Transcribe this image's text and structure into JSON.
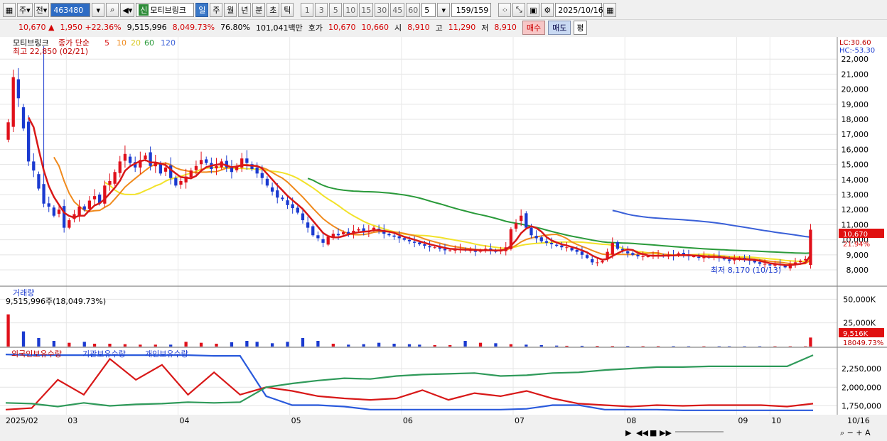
{
  "toolbar": {
    "market": "주",
    "market2": "전",
    "code": "463480",
    "stock_tag": "신",
    "stock_name": "모티브링크",
    "periods": [
      "일",
      "주",
      "월",
      "년",
      "분",
      "초",
      "틱"
    ],
    "numbers": [
      "1",
      "3",
      "5",
      "10",
      "15",
      "30",
      "45",
      "60"
    ],
    "count": "5",
    "page": "159",
    "page_total": "/159",
    "date": "2025/10/16"
  },
  "quote": {
    "price": "10,670",
    "arrow": "▲",
    "change": "1,950",
    "change_pct": "+22.36%",
    "volume": "9,515,996",
    "volume_pct": "8,049.73%",
    "rate": "76.80%",
    "amount": "101,041백만",
    "ask_label": "호가",
    "ask": "10,670",
    "bid": "10,660",
    "open_label": "시",
    "open": "8,910",
    "high_label": "고",
    "high": "11,290",
    "low_label": "저",
    "low": "8,910",
    "buy": "매수",
    "sell": "매도",
    "eval": "평"
  },
  "legend": {
    "name": "모티브링크",
    "ma_label": "종가 단순",
    "ma_periods": [
      "5",
      "10",
      "20",
      "60",
      "120"
    ],
    "max_label": "최고 22,850 (02/21)",
    "min_label": "최저 8,170 (10/13)",
    "lc": "LC:30.60",
    "hc": "HC:-53.30",
    "last_price_tag": "10,670",
    "last_pct_tag": "21.94%"
  },
  "volume_panel": {
    "title": "거래량",
    "value": "9,515,996주(18,049.73%)",
    "axis": [
      "50,000K",
      "25,000K"
    ],
    "last_tag": "9,516K",
    "last_tag2": "18049.73%"
  },
  "holding_panel": {
    "titles": [
      "외국인보유수량",
      "기관보유수량",
      "개인보유수량"
    ],
    "axis": [
      "2,250,000",
      "2,000,000",
      "1,750,000"
    ]
  },
  "colors": {
    "up": "#e0101a",
    "down": "#1a3ad0",
    "ma5": "#d81818",
    "ma10": "#f08a1c",
    "ma20": "#f2e22a",
    "ma60": "#2a9a3a",
    "ma120": "#3a60d8",
    "foreign": "#2a5adc",
    "institution": "#d81818",
    "individual": "#2f9a5a"
  },
  "chart_data": [
    {
      "type": "candlestick",
      "title": "모티브링크",
      "x_labels": [
        "2025/02",
        "03",
        "04",
        "05",
        "06",
        "07",
        "08",
        "09",
        "10",
        "10/16"
      ],
      "ylim": [
        7200,
        23000
      ],
      "y_ticks": [
        "22,000",
        "21,000",
        "20,000",
        "19,000",
        "18,000",
        "17,000",
        "16,000",
        "15,000",
        "14,000",
        "13,000",
        "12,000",
        "11,000",
        "10,000",
        "9,000",
        "8,000"
      ],
      "phases": [
        {
          "name": "Feb",
          "from": 0,
          "to": 12,
          "close": [
            17800,
            20800,
            19400,
            17400,
            15200,
            14600,
            13400,
            12400,
            12200,
            11600,
            12000,
            10800
          ],
          "high": 22850
        },
        {
          "name": "Mar",
          "from": 12,
          "to": 34,
          "close": [
            11300,
            11700,
            12200,
            12000,
            12600,
            12900,
            12400,
            13600,
            13900,
            14500,
            15200,
            15700,
            15100,
            14800,
            15300,
            15600,
            14900,
            15100,
            14400,
            14800,
            14100,
            13600
          ]
        },
        {
          "name": "Apr",
          "from": 34,
          "to": 56,
          "close": [
            13900,
            14200,
            14600,
            14900,
            15300,
            15100,
            14700,
            14900,
            15200,
            14800,
            14500,
            14900,
            15400,
            15100,
            14700,
            14400,
            14100,
            13600,
            13200,
            12800,
            12700,
            12300
          ]
        },
        {
          "name": "May",
          "from": 56,
          "to": 78,
          "close": [
            12100,
            11800,
            11300,
            10800,
            10300,
            10100,
            9800,
            10200,
            10400,
            10300,
            10500,
            10400,
            10600,
            10700,
            10500,
            10600,
            10800,
            10600,
            10400,
            10300,
            10200,
            10100
          ]
        },
        {
          "name": "Jun",
          "from": 78,
          "to": 100,
          "close": [
            10000,
            9900,
            9800,
            9700,
            9600,
            9500,
            9500,
            9400,
            9300,
            9300,
            9400,
            9400,
            9300,
            9300,
            9200,
            9300,
            9400,
            9300,
            9200,
            9300,
            9500,
            10700
          ]
        },
        {
          "name": "Jul",
          "from": 100,
          "to": 122,
          "close": [
            11100,
            11600,
            10800,
            10300,
            10100,
            9900,
            9800,
            9700,
            9600,
            9500,
            9500,
            9300,
            9200,
            9000,
            8800,
            8500,
            8500,
            8600,
            9200,
            9800,
            9400,
            9300
          ]
        },
        {
          "name": "Aug",
          "from": 122,
          "to": 144,
          "close": [
            9100,
            9000,
            8900,
            8900,
            8900,
            9000,
            9000,
            8900,
            9000,
            8900,
            9100,
            9000,
            8900,
            8900,
            8800,
            8900,
            8800,
            8900,
            8800,
            8700,
            8600,
            8700
          ]
        },
        {
          "name": "Sep-Oct",
          "from": 144,
          "to": 159,
          "close": [
            8800,
            8700,
            8600,
            8500,
            8400,
            8400,
            8300,
            8400,
            8300,
            8170,
            8400,
            8500,
            8600,
            8720,
            10670
          ]
        }
      ],
      "last_close": 10670,
      "max": {
        "value": 22850,
        "date": "02/21"
      },
      "min": {
        "value": 8170,
        "date": "10/13"
      }
    },
    {
      "type": "bar",
      "title": "거래량",
      "ylim": [
        0,
        60000
      ],
      "y_unit": "K",
      "values": [
        34000,
        16000,
        9000,
        6000,
        4000,
        5000,
        3000,
        3000,
        2500,
        2000,
        2000,
        2000,
        5000,
        4000,
        3000,
        4500,
        6000,
        5000,
        3500,
        5000,
        9000,
        6000,
        3000,
        2000,
        2500,
        4000,
        3000,
        2500,
        2000,
        1500,
        1500,
        6000,
        4000,
        3500,
        2500,
        2000,
        1500,
        1000,
        800,
        800,
        700,
        600,
        600,
        500,
        500,
        500,
        400,
        400,
        400,
        400,
        400,
        400,
        400,
        400,
        400,
        9516
      ],
      "last": 9516
    },
    {
      "type": "line",
      "title": "외국인보유수량 · 기관보유수량 · 개인보유수량",
      "ylim": [
        1650000,
        2450000
      ],
      "series": [
        {
          "name": "외국인보유수량",
          "values": [
            2440000,
            2430000,
            2430000,
            2430000,
            2430000,
            2430000,
            2430000,
            2430000,
            2420000,
            2420000,
            1880000,
            1760000,
            1760000,
            1740000,
            1700000,
            1700000,
            1700000,
            1700000,
            1700000,
            1700000,
            1710000,
            1760000,
            1760000,
            1700000,
            1700000,
            1700000,
            1690000,
            1690000,
            1690000,
            1690000,
            1690000,
            1690000
          ]
        },
        {
          "name": "기관보유수량",
          "values": [
            1700000,
            1720000,
            2100000,
            1900000,
            2380000,
            2100000,
            2300000,
            1900000,
            2200000,
            1900000,
            2000000,
            1950000,
            1880000,
            1850000,
            1830000,
            1850000,
            1960000,
            1830000,
            1920000,
            1880000,
            1950000,
            1850000,
            1780000,
            1760000,
            1740000,
            1760000,
            1750000,
            1760000,
            1760000,
            1760000,
            1740000,
            1780000
          ]
        },
        {
          "name": "개인보유수량",
          "values": [
            1790000,
            1780000,
            1740000,
            1790000,
            1750000,
            1770000,
            1780000,
            1800000,
            1790000,
            1800000,
            2000000,
            2050000,
            2090000,
            2120000,
            2110000,
            2150000,
            2170000,
            2180000,
            2190000,
            2150000,
            2160000,
            2190000,
            2200000,
            2230000,
            2250000,
            2270000,
            2270000,
            2280000,
            2280000,
            2280000,
            2280000,
            2430000
          ]
        }
      ]
    }
  ]
}
